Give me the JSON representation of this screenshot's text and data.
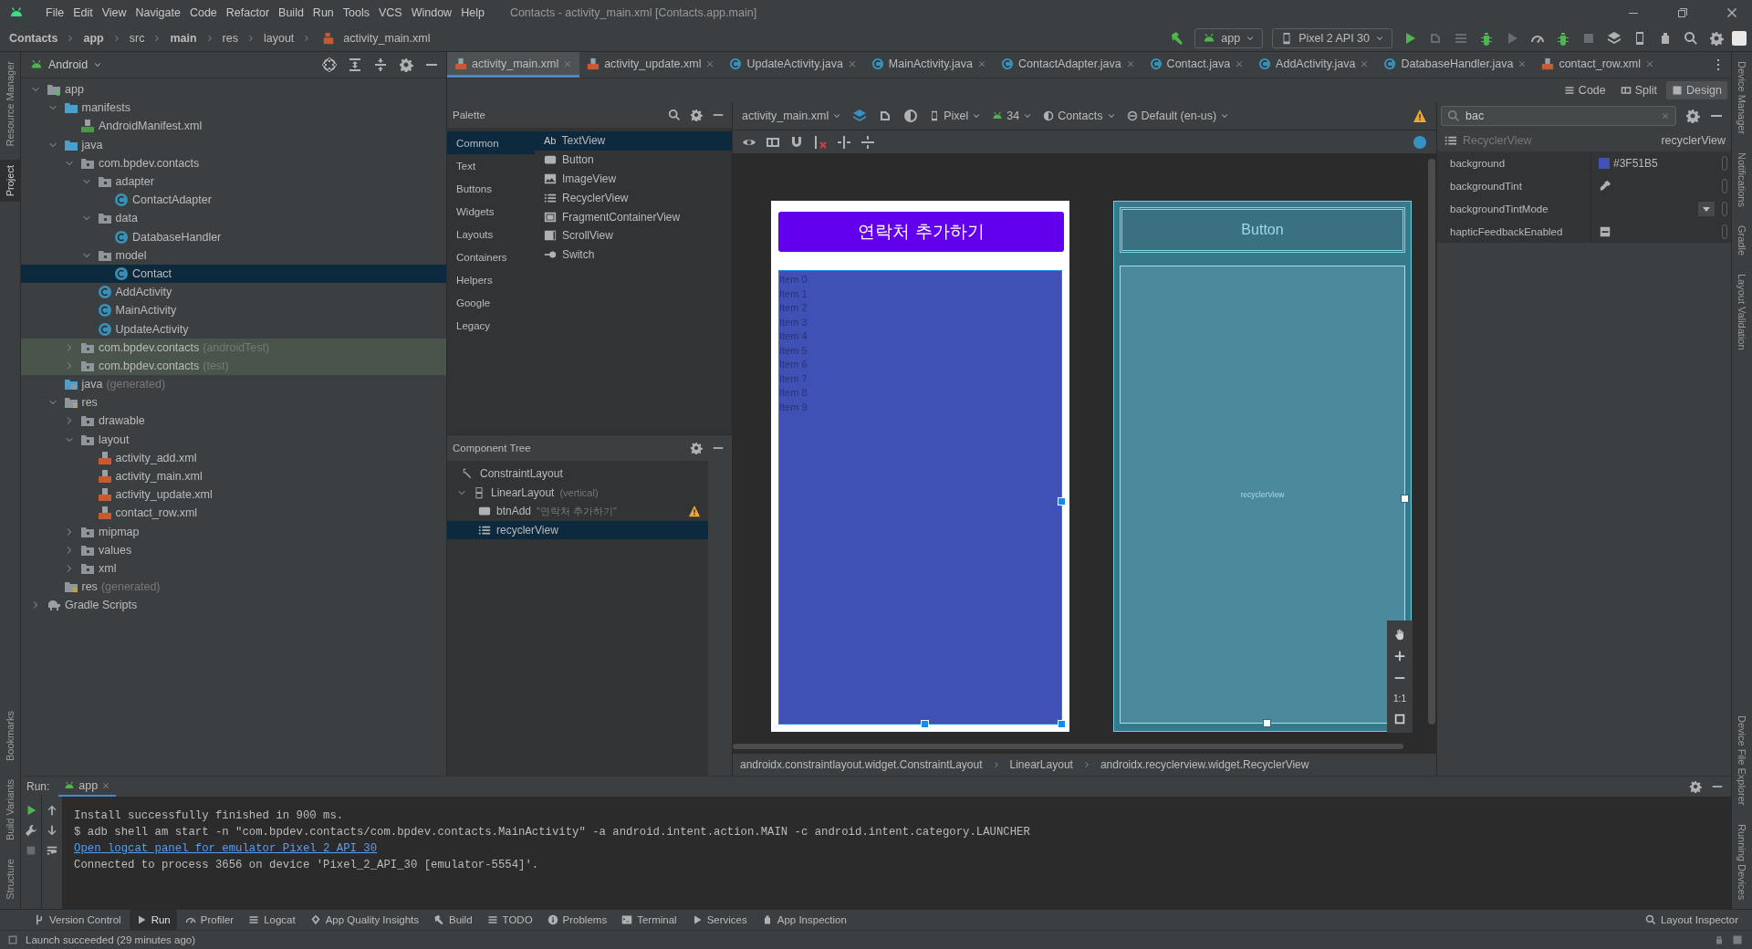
{
  "menu_bar": {
    "items": [
      "File",
      "Edit",
      "View",
      "Navigate",
      "Code",
      "Refactor",
      "Build",
      "Run",
      "Tools",
      "VCS",
      "Window",
      "Help"
    ],
    "title": "Contacts - activity_main.xml [Contacts.app.main]"
  },
  "breadcrumb": [
    {
      "label": "Contacts",
      "bold": true
    },
    {
      "label": "app",
      "bold": true
    },
    {
      "label": "src",
      "bold": false
    },
    {
      "label": "main",
      "bold": true
    },
    {
      "label": "res",
      "bold": false
    },
    {
      "label": "layout",
      "bold": false
    },
    {
      "label": "activity_main.xml",
      "bold": false
    }
  ],
  "run_toolbar": {
    "configuration": "app",
    "device": "Pixel 2 API 30"
  },
  "left_strip": {
    "top": [
      {
        "label": "Resource Manager",
        "selected": false
      },
      {
        "label": "Project",
        "selected": true
      }
    ],
    "bottom": [
      {
        "label": "Bookmarks",
        "selected": false
      },
      {
        "label": "Build Variants",
        "selected": false
      },
      {
        "label": "Structure",
        "selected": false
      }
    ]
  },
  "right_strip": {
    "top": [
      {
        "label": "Device Manager"
      },
      {
        "label": "Notifications"
      },
      {
        "label": "Gradle"
      },
      {
        "label": "Layout Validation"
      }
    ],
    "bottom": [
      {
        "label": "Device File Explorer"
      },
      {
        "label": "Running Devices"
      }
    ]
  },
  "project": {
    "view": "Android",
    "tree": [
      {
        "label": "app",
        "kind": "module",
        "expanded": true,
        "selected": false,
        "children": [
          {
            "label": "manifests",
            "kind": "folder",
            "expanded": true,
            "selected": false,
            "children": [
              {
                "label": "AndroidManifest.xml",
                "kind": "manifest",
                "selected": false
              }
            ]
          },
          {
            "label": "java",
            "kind": "folder",
            "expanded": true,
            "selected": false,
            "children": [
              {
                "label": "com.bpdev.contacts",
                "kind": "package",
                "expanded": true,
                "selected": false,
                "children": [
                  {
                    "label": "adapter",
                    "kind": "package",
                    "expanded": true,
                    "selected": false,
                    "children": [
                      {
                        "label": "ContactAdapter",
                        "kind": "class",
                        "selected": false
                      }
                    ]
                  },
                  {
                    "label": "data",
                    "kind": "package",
                    "expanded": true,
                    "selected": false,
                    "children": [
                      {
                        "label": "DatabaseHandler",
                        "kind": "class",
                        "selected": false
                      }
                    ]
                  },
                  {
                    "label": "model",
                    "kind": "package",
                    "expanded": true,
                    "selected": false,
                    "children": [
                      {
                        "label": "Contact",
                        "kind": "class",
                        "selected": true
                      }
                    ]
                  },
                  {
                    "label": "AddActivity",
                    "kind": "class",
                    "selected": false
                  },
                  {
                    "label": "MainActivity",
                    "kind": "class",
                    "selected": false
                  },
                  {
                    "label": "UpdateActivity",
                    "kind": "class",
                    "selected": false
                  }
                ]
              },
              {
                "label": "com.bpdev.contacts",
                "suffix": "(androidTest)",
                "kind": "test_package",
                "expanded": false,
                "selected": false
              },
              {
                "label": "com.bpdev.contacts",
                "suffix": "(test)",
                "kind": "test_package",
                "expanded": false,
                "selected": false
              }
            ]
          },
          {
            "label": "java",
            "suffix": "(generated)",
            "kind": "generated",
            "selected": false
          },
          {
            "label": "res",
            "kind": "res",
            "expanded": true,
            "selected": false,
            "children": [
              {
                "label": "drawable",
                "kind": "package",
                "expanded": false,
                "selected": false
              },
              {
                "label": "layout",
                "kind": "package",
                "expanded": true,
                "selected": false,
                "children": [
                  {
                    "label": "activity_add.xml",
                    "kind": "xml",
                    "selected": false
                  },
                  {
                    "label": "activity_main.xml",
                    "kind": "xml",
                    "selected": false
                  },
                  {
                    "label": "activity_update.xml",
                    "kind": "xml",
                    "selected": false
                  },
                  {
                    "label": "contact_row.xml",
                    "kind": "xml",
                    "selected": false
                  }
                ]
              },
              {
                "label": "mipmap",
                "kind": "package",
                "expanded": false,
                "selected": false
              },
              {
                "label": "values",
                "kind": "package",
                "expanded": false,
                "selected": false
              },
              {
                "label": "xml",
                "kind": "package",
                "expanded": false,
                "selected": false
              }
            ]
          },
          {
            "label": "res",
            "suffix": "(generated)",
            "kind": "res",
            "selected": false
          }
        ]
      },
      {
        "label": "Gradle Scripts",
        "kind": "gradle",
        "expanded": false,
        "selected": false
      }
    ]
  },
  "editor_tabs": [
    {
      "label": "activity_main.xml",
      "kind": "xml",
      "selected": true
    },
    {
      "label": "activity_update.xml",
      "kind": "xml",
      "selected": false
    },
    {
      "label": "UpdateActivity.java",
      "kind": "java",
      "selected": false
    },
    {
      "label": "MainActivity.java",
      "kind": "java",
      "selected": false
    },
    {
      "label": "ContactAdapter.java",
      "kind": "java",
      "selected": false
    },
    {
      "label": "Contact.java",
      "kind": "java",
      "selected": false
    },
    {
      "label": "AddActivity.java",
      "kind": "java",
      "selected": false
    },
    {
      "label": "DatabaseHandler.java",
      "kind": "java",
      "selected": false
    },
    {
      "label": "contact_row.xml",
      "kind": "xml",
      "selected": false
    }
  ],
  "view_modes": [
    {
      "label": "Code",
      "selected": false
    },
    {
      "label": "Split",
      "selected": false
    },
    {
      "label": "Design",
      "selected": true
    }
  ],
  "palette": {
    "title": "Palette",
    "categories": [
      {
        "label": "Common",
        "selected": true
      },
      {
        "label": "Text",
        "selected": false
      },
      {
        "label": "Buttons",
        "selected": false
      },
      {
        "label": "Widgets",
        "selected": false
      },
      {
        "label": "Layouts",
        "selected": false
      },
      {
        "label": "Containers",
        "selected": false
      },
      {
        "label": "Helpers",
        "selected": false
      },
      {
        "label": "Google",
        "selected": false
      },
      {
        "label": "Legacy",
        "selected": false
      }
    ],
    "items": [
      {
        "label": "TextView",
        "glyph": "Ab",
        "kind": "text",
        "selected": true
      },
      {
        "label": "Button",
        "kind": "button",
        "selected": false
      },
      {
        "label": "ImageView",
        "kind": "image",
        "selected": false
      },
      {
        "label": "RecyclerView",
        "kind": "list",
        "selected": false
      },
      {
        "label": "FragmentContainerView",
        "kind": "frame",
        "selected": false
      },
      {
        "label": "ScrollView",
        "kind": "scroll",
        "selected": false
      },
      {
        "label": "Switch",
        "kind": "switch",
        "selected": false
      }
    ]
  },
  "component_tree": {
    "title": "Component Tree",
    "nodes": [
      {
        "label": "ConstraintLayout",
        "kind": "constraint",
        "selected": false,
        "warning": false
      },
      {
        "label": "LinearLayout",
        "note": "(vertical)",
        "kind": "linear",
        "expanded": true,
        "selected": false,
        "warning": false,
        "children": [
          {
            "label": "btnAdd",
            "note": "\"연락처 추가하기\"",
            "kind": "button",
            "selected": false,
            "warning": true
          },
          {
            "label": "recyclerView",
            "kind": "list",
            "selected": true,
            "warning": false
          }
        ]
      }
    ]
  },
  "design_toolbar": {
    "file": "activity_main.xml",
    "device": "Pixel",
    "api": "34",
    "theme": "Contacts",
    "locale": "Default (en-us)"
  },
  "preview": {
    "button_text": "연락처 추가하기",
    "items": [
      "Item 0",
      "Item 1",
      "Item 2",
      "Item 3",
      "Item 4",
      "Item 5",
      "Item 6",
      "Item 7",
      "Item 8",
      "Item 9"
    ]
  },
  "blueprint": {
    "button_text": "Button",
    "list_label": "recyclerView"
  },
  "zoom_controls": {
    "reset": "1:1"
  },
  "attributes": {
    "search": "bac",
    "class": "RecyclerView",
    "id": "recyclerView",
    "rows": [
      {
        "name": "background",
        "kind": "color",
        "value": "#3F51B5",
        "color": "#3f51b5"
      },
      {
        "name": "backgroundTint",
        "kind": "picker"
      },
      {
        "name": "backgroundTintMode",
        "kind": "dropdown"
      },
      {
        "name": "hapticFeedbackEnabled",
        "kind": "flag"
      }
    ]
  },
  "layout_path": [
    "androidx.constraintlayout.widget.ConstraintLayout",
    "LinearLayout",
    "androidx.recyclerview.widget.RecyclerView"
  ],
  "run_panel": {
    "title": "Run:",
    "tab": "app",
    "lines": [
      {
        "text": "Install successfully finished in 900 ms.",
        "kind": "text"
      },
      {
        "text": "$ adb shell am start -n \"com.bpdev.contacts/com.bpdev.contacts.MainActivity\" -a android.intent.action.MAIN -c android.intent.category.LAUNCHER",
        "kind": "text"
      },
      {
        "text": "Open logcat panel for emulator Pixel 2 API 30",
        "kind": "link"
      },
      {
        "text": "Connected to process 3656 on device 'Pixel_2_API_30 [emulator-5554]'.",
        "kind": "text"
      }
    ]
  },
  "tool_windows": [
    {
      "label": "Version Control",
      "kind": "branch",
      "selected": false
    },
    {
      "label": "Run",
      "kind": "play",
      "selected": true
    },
    {
      "label": "Profiler",
      "kind": "gauge",
      "selected": false
    },
    {
      "label": "Logcat",
      "kind": "list",
      "selected": false
    },
    {
      "label": "App Quality Insights",
      "kind": "diamond",
      "selected": false
    },
    {
      "label": "Build",
      "kind": "hammer",
      "selected": false
    },
    {
      "label": "TODO",
      "kind": "list",
      "selected": false
    },
    {
      "label": "Problems",
      "kind": "info",
      "selected": false
    },
    {
      "label": "Terminal",
      "kind": "terminal",
      "selected": false
    },
    {
      "label": "Services",
      "kind": "play",
      "selected": false
    },
    {
      "label": "App Inspection",
      "kind": "robot",
      "selected": false
    }
  ],
  "layout_inspector": "Layout Inspector",
  "status": "Launch succeeded (29 minutes ago)"
}
